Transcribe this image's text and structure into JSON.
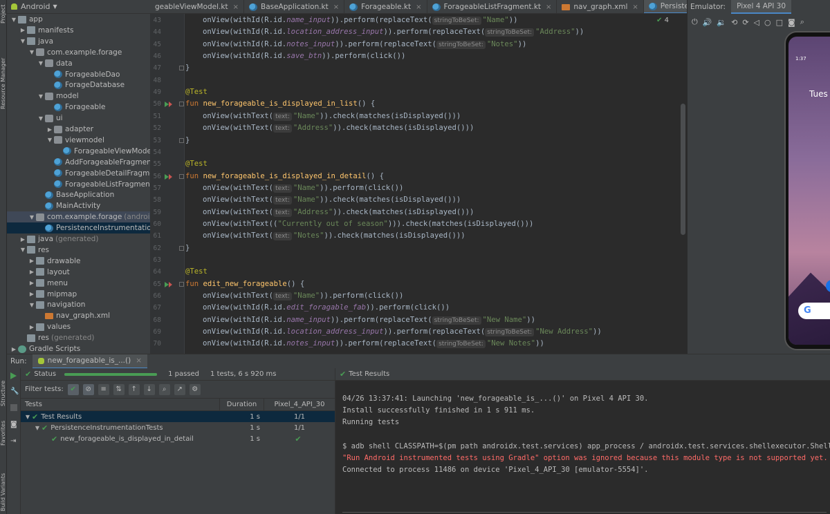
{
  "side_tabs": {
    "project": "Project",
    "resource_manager": "Resource Manager",
    "structure": "Structure",
    "favorites": "Favorites",
    "build_variants": "Build Variants"
  },
  "project_panel": {
    "view_selector": "Android",
    "tree": [
      {
        "label": "app",
        "suffix": "",
        "icon": "folder-icon"
      },
      {
        "label": "manifests",
        "suffix": "",
        "icon": "folder-icon"
      },
      {
        "label": "java",
        "suffix": "",
        "icon": "folder-icon"
      },
      {
        "label": "com.example.forage",
        "suffix": "",
        "icon": "package-icon"
      },
      {
        "label": "data",
        "suffix": "",
        "icon": "package-icon"
      },
      {
        "label": "ForageableDao",
        "suffix": "",
        "icon": "kotlin-file-icon"
      },
      {
        "label": "ForageDatabase",
        "suffix": "",
        "icon": "kotlin-file-icon"
      },
      {
        "label": "model",
        "suffix": "",
        "icon": "package-icon"
      },
      {
        "label": "Forageable",
        "suffix": "",
        "icon": "kotlin-file-icon"
      },
      {
        "label": "ui",
        "suffix": "",
        "icon": "package-icon"
      },
      {
        "label": "adapter",
        "suffix": "",
        "icon": "package-icon"
      },
      {
        "label": "viewmodel",
        "suffix": "",
        "icon": "package-icon"
      },
      {
        "label": "ForageableViewModel.kt",
        "suffix": "",
        "icon": "kotlin-file-icon"
      },
      {
        "label": "AddForageableFragment",
        "suffix": "",
        "icon": "kotlin-file-icon"
      },
      {
        "label": "ForageableDetailFragment",
        "suffix": "",
        "icon": "kotlin-file-icon"
      },
      {
        "label": "ForageableListFragment",
        "suffix": "",
        "icon": "kotlin-file-icon"
      },
      {
        "label": "BaseApplication",
        "suffix": "",
        "icon": "kotlin-file-icon"
      },
      {
        "label": "MainActivity",
        "suffix": "",
        "icon": "kotlin-file-icon"
      },
      {
        "label": "com.example.forage",
        "suffix": "(androidTest)",
        "icon": "package-icon"
      },
      {
        "label": "PersistenceInstrumentationTests",
        "suffix": "",
        "icon": "kotlin-file-icon"
      },
      {
        "label": "java",
        "suffix": "(generated)",
        "icon": "folder-icon"
      },
      {
        "label": "res",
        "suffix": "",
        "icon": "folder-icon"
      },
      {
        "label": "drawable",
        "suffix": "",
        "icon": "folder-icon"
      },
      {
        "label": "layout",
        "suffix": "",
        "icon": "folder-icon"
      },
      {
        "label": "menu",
        "suffix": "",
        "icon": "folder-icon"
      },
      {
        "label": "mipmap",
        "suffix": "",
        "icon": "folder-icon"
      },
      {
        "label": "navigation",
        "suffix": "",
        "icon": "folder-icon"
      },
      {
        "label": "nav_graph.xml",
        "suffix": "",
        "icon": "xml-file-icon"
      },
      {
        "label": "values",
        "suffix": "",
        "icon": "folder-icon"
      },
      {
        "label": "res",
        "suffix": "(generated)",
        "icon": "folder-icon"
      },
      {
        "label": "Gradle Scripts",
        "suffix": "",
        "icon": "gradle-icon"
      }
    ]
  },
  "editor_tabs": [
    {
      "label": "geableViewModel.kt"
    },
    {
      "label": "BaseApplication.kt"
    },
    {
      "label": "Forageable.kt"
    },
    {
      "label": "ForageableListFragment.kt"
    },
    {
      "label": "nav_graph.xml"
    },
    {
      "label": "PersistenceInstrumentationTests.kt"
    }
  ],
  "editor": {
    "inspection_count": "4",
    "line_numbers": [
      "43",
      "44",
      "45",
      "46",
      "47",
      "48",
      "49",
      "50",
      "51",
      "52",
      "53",
      "54",
      "55",
      "56",
      "57",
      "58",
      "59",
      "60",
      "61",
      "62",
      "63",
      "64",
      "65",
      "66",
      "67",
      "68",
      "69",
      "70"
    ],
    "strings": {
      "ann": "@Test",
      "fun": "fun ",
      "f1": "new_forageable_is_displayed_in_list",
      "f2": "new_forageable_is_displayed_in_detail",
      "f3": "edit_new_forageable",
      "sig_end": "() {",
      "close": "}",
      "hint_text": "text:",
      "hint_string": "stringToBeSet:",
      "name": "\"Name\"",
      "address": "\"Address\"",
      "notes": "\"Notes\"",
      "season": "\"Currently out of season\"",
      "new_name": "\"New Name\"",
      "new_address": "\"New Address\"",
      "new_notes": "\"New Notes\"",
      "name_input": "name_input",
      "location_input": "location_address_input",
      "notes_input": "notes_input",
      "save_btn": "save_btn",
      "edit_fab": "edit_foragable_fab",
      "ov_with_id": "onView(withId(R.id.",
      "ov_with_text": "onView(withText(",
      "ov_with_text_paren": "onView(withText((",
      "perform_replace": ")).perform(replaceText(",
      "perform_click_tail": ")).perform(click())",
      "check_tail": ")).check(matches(isDisplayed()))",
      "close_call": "))",
      "season_tail": "))).check(matches(isDisplayed()))"
    }
  },
  "emulator": {
    "label": "Emulator:",
    "device_tab": "Pixel 4 API 30",
    "screen_time": "1:37",
    "screen_date": "Tues",
    "search_logo": "G"
  },
  "run_panel": {
    "label": "Run:",
    "config_tab": "new_forageable_is_...()",
    "status_label": "Status",
    "progress_fraction": 1.0,
    "passed": "1 passed",
    "summary": "1 tests, 6 s 920 ms",
    "filter_label": "Filter tests:",
    "columns": {
      "tests": "Tests",
      "duration": "Duration",
      "device": "Pixel_4_API_30"
    },
    "rows": [
      {
        "name": "Test Results",
        "duration": "1 s",
        "result": "1/1"
      },
      {
        "name": "PersistenceInstrumentationTests",
        "duration": "1 s",
        "result": "1/1"
      },
      {
        "name": "new_forageable_is_displayed_in_detail",
        "duration": "1 s",
        "result": ""
      }
    ],
    "output_header": "Test Results",
    "output_lines": [
      {
        "text": "04/26 13:37:41: Launching 'new_forageable_is_...()' on Pixel 4 API 30.",
        "type": "normal"
      },
      {
        "text": "Install successfully finished in 1 s 911 ms.",
        "type": "normal"
      },
      {
        "text": "Running tests",
        "type": "normal"
      },
      {
        "text": "",
        "type": "normal"
      },
      {
        "text": "$ adb shell CLASSPATH=$(pm path androidx.test.services) app_process / androidx.test.services.shellexecutor.ShellMain am i",
        "type": "normal"
      },
      {
        "text": "\"Run Android instrumented tests using Gradle\" option was ignored because this module type is not supported yet.",
        "type": "err"
      },
      {
        "text": "Connected to process 11486 on device 'Pixel_4_API_30 [emulator-5554]'.",
        "type": "normal"
      }
    ]
  },
  "colors": {
    "accent": "#4a88c7",
    "success": "#499c54",
    "error": "#ff6b68"
  }
}
